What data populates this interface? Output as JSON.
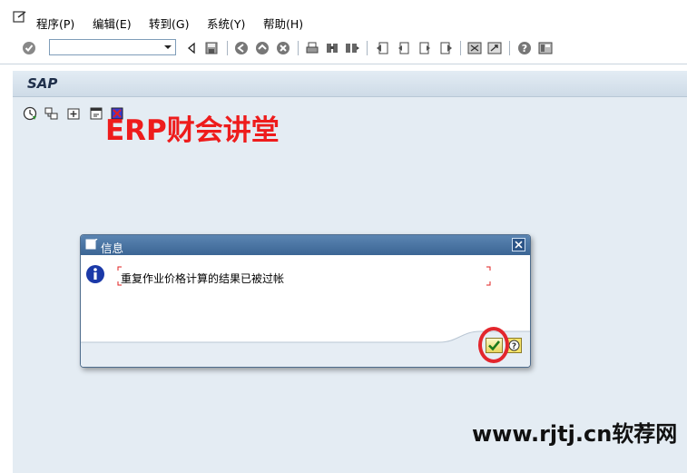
{
  "menu": {
    "items": [
      {
        "label": "程序(P)"
      },
      {
        "label": "编辑(E)"
      },
      {
        "label": "转到(G)"
      },
      {
        "label": "系统(Y)"
      },
      {
        "label": "帮助(H)"
      }
    ]
  },
  "toolbar": {
    "command_field_value": "",
    "icons": [
      "enter-icon",
      "command-dropdown-icon",
      "collapse-icon",
      "save-icon",
      "back-icon",
      "exit-icon",
      "cancel-icon",
      "print-icon",
      "find-icon",
      "find-next-icon",
      "first-page-icon",
      "previous-page-icon",
      "next-page-icon",
      "last-page-icon",
      "create-session-icon",
      "shortcut-icon",
      "help-icon",
      "layout-icon"
    ]
  },
  "screen": {
    "title": "SAP",
    "app_icons": [
      "execute-icon",
      "hierarchy-icon",
      "new-node-icon",
      "document-icon",
      "task-icon"
    ]
  },
  "watermarks": {
    "top": "ERP财会讲堂",
    "bottom": "www.rjtj.cn软荐网"
  },
  "dialog": {
    "title": "信息",
    "message": "重复作业价格计算的结果已被过帐",
    "icons": [
      "info-icon",
      "ok-check-icon",
      "help-icon",
      "close-icon"
    ]
  },
  "colors": {
    "workarea": "#e4ecf3",
    "dialog_title": "#3b6594",
    "watermark_red": "#ee1c1c",
    "highlight": "#e3262d"
  }
}
